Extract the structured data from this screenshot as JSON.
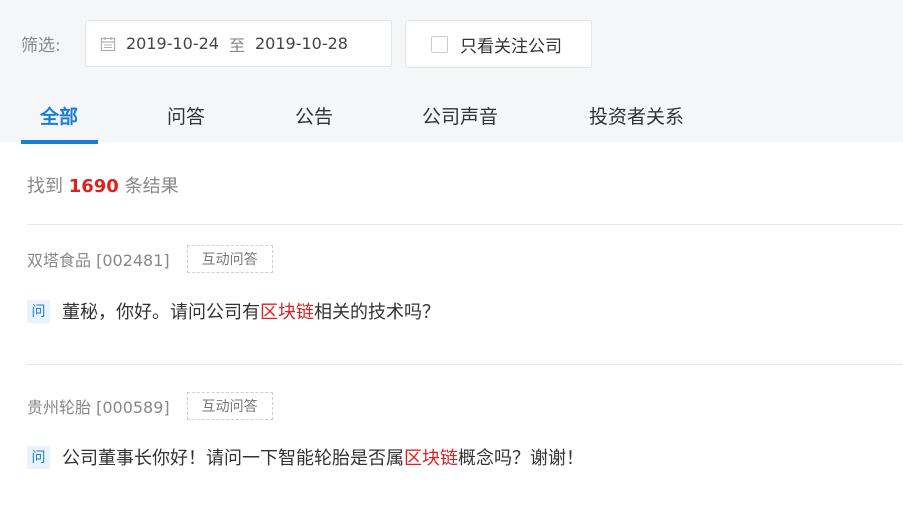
{
  "filter": {
    "label": "筛选:",
    "date_from": "2019-10-24",
    "date_sep": "至",
    "date_to": "2019-10-28",
    "follow_only_label": "只看关注公司",
    "follow_only_checked": false
  },
  "tabs": [
    {
      "label": "全部",
      "active": true
    },
    {
      "label": "问答",
      "active": false
    },
    {
      "label": "公告",
      "active": false
    },
    {
      "label": "公司声音",
      "active": false
    },
    {
      "label": "投资者关系",
      "active": false
    }
  ],
  "results": {
    "prefix": "找到",
    "count": "1690",
    "suffix": "条结果"
  },
  "items": [
    {
      "company": "双塔食品 [002481]",
      "tag": "互动问答",
      "badge": "问",
      "q_before": "董秘，你好。请问公司有",
      "q_keyword": "区块链",
      "q_after": "相关的技术吗？"
    },
    {
      "company": "贵州轮胎 [000589]",
      "tag": "互动问答",
      "badge": "问",
      "q_before": "公司董事长你好！请问一下智能轮胎是否属",
      "q_keyword": "区块链",
      "q_after": "概念吗？谢谢！"
    }
  ],
  "colors": {
    "accent": "#1a7ed6",
    "highlight": "#e02020",
    "header_bg": "#f5f6f8"
  }
}
